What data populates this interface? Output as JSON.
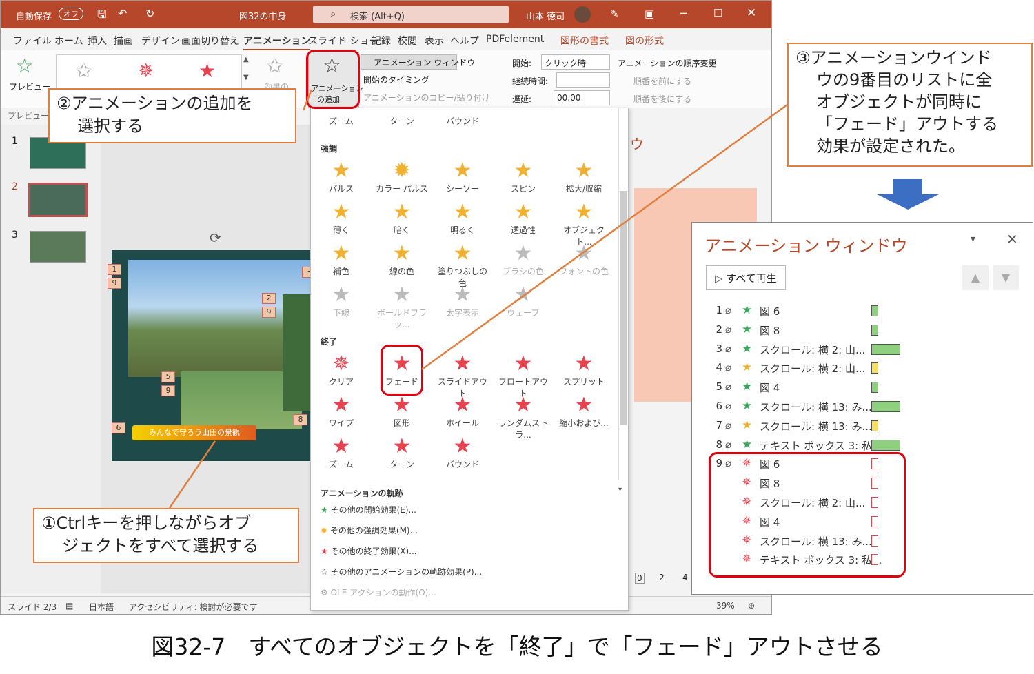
{
  "titlebar": {
    "autosave": "自動保存",
    "autosave_state": "オフ",
    "filename": "図32の中身",
    "search_placeholder": "検索 (Alt+Q)",
    "user": "山本 徳司"
  },
  "tabs": [
    "ファイル",
    "ホーム",
    "挿入",
    "描画",
    "デザイン",
    "画面切り替え",
    "アニメーション",
    "スライド ショー",
    "記録",
    "校閲",
    "表示",
    "ヘルプ",
    "PDFelement",
    "図形の書式",
    "図の形式"
  ],
  "ribbon": {
    "preview": "プレビュー",
    "preview_group": "プレビュー",
    "add_anim_line1": "アニメーション",
    "add_anim_line2": "の追加",
    "anim_window": "アニメーション ウィンドウ",
    "trigger": "開始のタイミング",
    "copy_paste": "アニメーションのコピー/貼り付け",
    "start_label": "開始:",
    "start_value": "クリック時",
    "duration_label": "継続時間:",
    "delay_label": "遅延:",
    "delay_value": "00.00",
    "reorder": "アニメーションの順序変更",
    "move_earlier": "順番を前にする",
    "move_later": "順番を後にする",
    "effect": "効果の"
  },
  "gallery": {
    "top_row": [
      "ズーム",
      "ターン",
      "バウンド"
    ],
    "emphasis_title": "強調",
    "emphasis": [
      [
        "パルス",
        "カラー パルス",
        "シーソー",
        "スピン",
        "拡大/収縮"
      ],
      [
        "薄く",
        "暗く",
        "明るく",
        "透過性",
        "オブジェクト..."
      ],
      [
        "補色",
        "線の色",
        "塗りつぶしの色",
        "ブラシの色",
        "フォントの色"
      ],
      [
        "下線",
        "ボールドフラッ...",
        "太字表示",
        "ウェーブ"
      ]
    ],
    "exit_title": "終了",
    "exit": [
      [
        "クリア",
        "フェード",
        "スライドアウト",
        "フロートアウト",
        "スプリット"
      ],
      [
        "ワイプ",
        "図形",
        "ホイール",
        "ランダムストラ...",
        "縮小および..."
      ],
      [
        "ズーム",
        "ターン",
        "バウンド"
      ]
    ],
    "motion_title": "アニメーションの軌跡",
    "more": [
      "その他の開始効果(E)...",
      "その他の強調効果(M)...",
      "その他の終了効果(X)...",
      "その他のアニメーションの軌跡効果(P)...",
      "OLE アクションの動作(O)..."
    ]
  },
  "slides": [
    "1",
    "2",
    "3"
  ],
  "slide_banner": "みんなで守ろう山田の景観",
  "slide_tags": [
    "1",
    "9",
    "2",
    "9",
    "5",
    "9",
    "6",
    "8",
    "3"
  ],
  "statusbar": {
    "slide": "スライド 2/3",
    "lang": "日本語",
    "access": "アクセシビリティ: 検討が必要です",
    "zoom": "39%"
  },
  "animpane": {
    "title": "アニメーション ウィンドウ",
    "play_all": "すべて再生",
    "rows": [
      {
        "num": "1",
        "name": "図 6",
        "type": "entry"
      },
      {
        "num": "2",
        "name": "図 8",
        "type": "entry"
      },
      {
        "num": "3",
        "name": "スクロール: 横 2: 山...",
        "type": "entry-path"
      },
      {
        "num": "4",
        "name": "スクロール: 横 2: 山...",
        "type": "emph"
      },
      {
        "num": "5",
        "name": "図 4",
        "type": "entry"
      },
      {
        "num": "6",
        "name": "スクロール: 横 13: み...",
        "type": "entry-path"
      },
      {
        "num": "7",
        "name": "スクロール: 横 13: み...",
        "type": "emph"
      },
      {
        "num": "8",
        "name": "テキスト ボックス 3: 私...",
        "type": "entry-path"
      },
      {
        "num": "9",
        "name": "図 6",
        "type": "exit"
      },
      {
        "num": "",
        "name": "図 8",
        "type": "exit"
      },
      {
        "num": "",
        "name": "スクロール: 横 2: 山...",
        "type": "exit"
      },
      {
        "num": "",
        "name": "図 4",
        "type": "exit"
      },
      {
        "num": "",
        "name": "スクロール: 横 13: み...",
        "type": "exit"
      },
      {
        "num": "",
        "name": "テキスト ボックス 3: 私...",
        "type": "exit"
      }
    ]
  },
  "callouts": {
    "c1_line1": "①Ctrlキーを押しながらオブ",
    "c1_line2": "ジェクトをすべて選択する",
    "c2_line1": "②アニメーションの追加を",
    "c2_line2": "選択する",
    "c3_line1": "③アニメーションウインド",
    "c3_line2": "ウの9番目のリストに全",
    "c3_line3": "オブジェクトが同時に",
    "c3_line4": "「フェード」アウトする",
    "c3_line5": "効果が設定された。"
  },
  "side_pane_partial": "ウ",
  "timeline": [
    "0",
    "2",
    "4"
  ],
  "caption": "図32-7　すべてのオブジェクトを「終了」で「フェード」アウトさせる",
  "colors": {
    "title": "#b7472a",
    "exit_star": "#e8424f",
    "entry_star": "#3aa85a",
    "emph_star": "#f0b030",
    "callout_border": "#e08040",
    "highlight": "#e00010"
  }
}
